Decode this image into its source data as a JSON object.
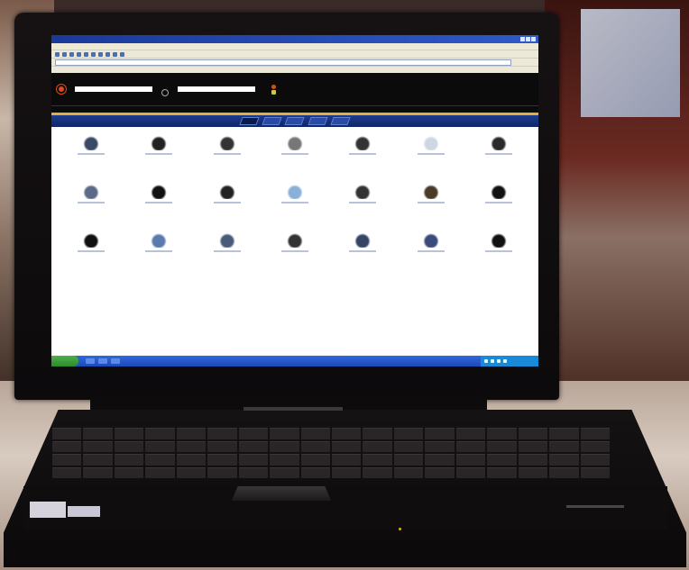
{
  "colors": {
    "site_header": "#0b0b0b",
    "nav_blue": "#1d3d8f",
    "accent_orange": "#e04a1a",
    "gold_rule": "#e0b040",
    "taskbar_blue": "#2f68e0",
    "laptop_body": "#0d0b0c"
  },
  "icons": {
    "logo": "corporate-express-logo",
    "start": "windows-start-icon",
    "cart": "shopping-cart-icon"
  },
  "products": [
    {
      "icon": "stapler-icon",
      "color": "#3a4a66"
    },
    {
      "icon": "printer-icon",
      "color": "#222"
    },
    {
      "icon": "laptop-icon",
      "color": "#333"
    },
    {
      "icon": "notebook-icon",
      "color": "#777"
    },
    {
      "icon": "clock-icon",
      "color": "#333"
    },
    {
      "icon": "paper-icon",
      "color": "#cfd6e4"
    },
    {
      "icon": "globe-icon",
      "color": "#2a2a2a"
    },
    {
      "icon": "chair-icon",
      "color": "#5a6a88"
    },
    {
      "icon": "fax-icon",
      "color": "#111"
    },
    {
      "icon": "phone-icon",
      "color": "#222"
    },
    {
      "icon": "folders-icon",
      "color": "#8ab0d8"
    },
    {
      "icon": "cartridge-icon",
      "color": "#333"
    },
    {
      "icon": "pens-icon",
      "color": "#4a3a2a"
    },
    {
      "icon": "monitor-icon",
      "color": "#111"
    },
    {
      "icon": "projector-icon",
      "color": "#111"
    },
    {
      "icon": "supplies-icon",
      "color": "#5a7ab0"
    },
    {
      "icon": "scissors-icon",
      "color": "#4a5a7a"
    },
    {
      "icon": "desk-icon",
      "color": "#333"
    },
    {
      "icon": "tv-icon",
      "color": "#334466"
    },
    {
      "icon": "cables-icon",
      "color": "#3a4a7a"
    },
    {
      "icon": "mouse-icon",
      "color": "#111"
    }
  ]
}
